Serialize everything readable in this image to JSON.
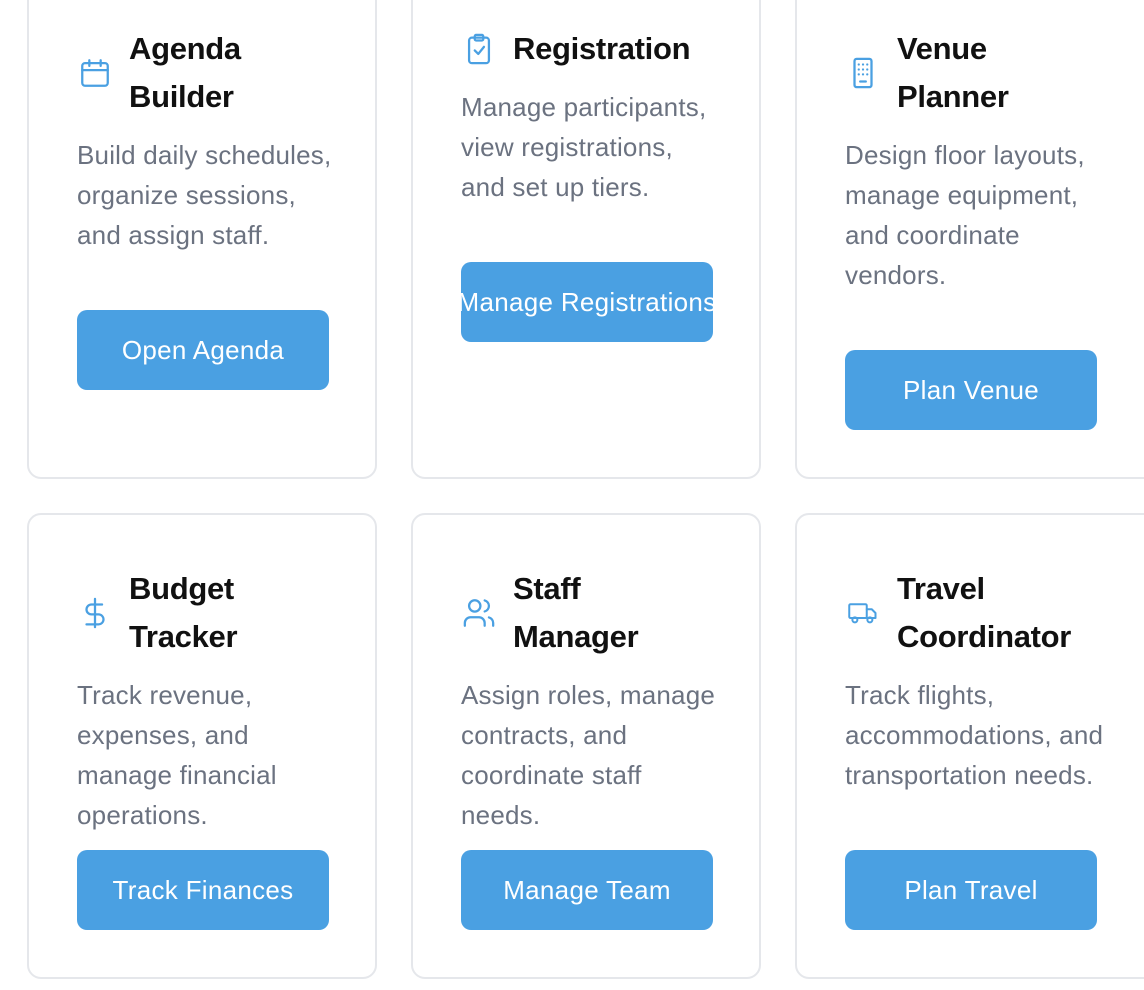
{
  "cards": [
    {
      "title_line1": "Agenda",
      "title_line2": "Builder",
      "icon": "calendar-icon",
      "description": "Build daily schedules, organize sessions, and assign staff.",
      "button_label": "Open Agenda"
    },
    {
      "title_line1": "Registration",
      "title_line2": "",
      "icon": "clipboard-check-icon",
      "description": "Manage participants, view registrations, and set up tiers.",
      "button_label": "Manage Registrations"
    },
    {
      "title_line1": "Venue",
      "title_line2": "Planner",
      "icon": "building-icon",
      "description": "Design floor layouts, manage equipment, and coordinate vendors.",
      "button_label": "Plan Venue"
    },
    {
      "title_line1": "Budget",
      "title_line2": "Tracker",
      "icon": "dollar-icon",
      "description": "Track revenue, expenses, and manage financial operations.",
      "button_label": "Track Finances"
    },
    {
      "title_line1": "Staff",
      "title_line2": "Manager",
      "icon": "users-icon",
      "description": "Assign roles, manage contracts, and coordinate staff needs.",
      "button_label": "Manage Team"
    },
    {
      "title_line1": "Travel",
      "title_line2": "Coordinator",
      "icon": "truck-icon",
      "description": "Track flights, accommodations, and transportation needs.",
      "button_label": "Plan Travel"
    }
  ],
  "colors": {
    "accent": "#4aa0e2",
    "title": "#111111",
    "description": "#6b7280",
    "border": "#e5e7eb"
  }
}
